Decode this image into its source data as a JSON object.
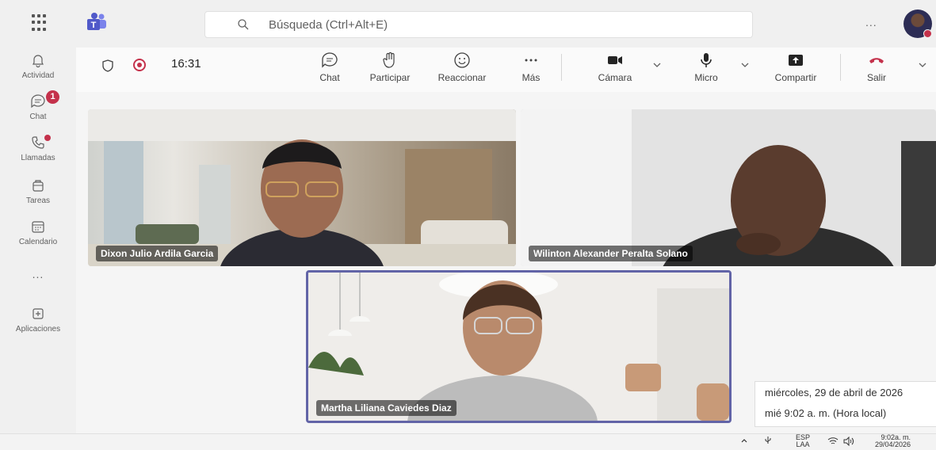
{
  "search": {
    "placeholder": "Búsqueda (Ctrl+Alt+E)"
  },
  "topbar": {
    "more_label": "..."
  },
  "rail": {
    "items": [
      {
        "label": "Actividad",
        "icon": "bell-icon"
      },
      {
        "label": "Chat",
        "icon": "chat-icon",
        "badge": "1"
      },
      {
        "label": "Llamadas",
        "icon": "phone-icon"
      },
      {
        "label": "Tareas",
        "icon": "tasks-icon"
      },
      {
        "label": "Calendario",
        "icon": "calendar-icon"
      },
      {
        "label": "...",
        "icon": "more-icon"
      },
      {
        "label": "Aplicaciones",
        "icon": "add-apps-icon"
      }
    ]
  },
  "toolbar": {
    "timer": "16:31",
    "chat": "Chat",
    "participar": "Participar",
    "reaccionar": "Reaccionar",
    "mas": "Más",
    "camara": "Cámara",
    "micro": "Micro",
    "compartir": "Compartir",
    "salir": "Salir"
  },
  "participants": [
    {
      "name": "Dixon Julio Ardila Garcia"
    },
    {
      "name": "Wilinton Alexander Peralta Solano"
    },
    {
      "name": "Martha Liliana Caviedes Diaz"
    }
  ],
  "clock_popup": {
    "date": "miércoles, 29 de abril de 2026",
    "time": "mié 9:02 a. m. (Hora local)"
  },
  "taskbar": {
    "lang": "ESP",
    "layout": "LAA",
    "time": "9:02a. m.",
    "date": "29/04/2026"
  },
  "colors": {
    "accent": "#6264a7",
    "leave": "#c4314b",
    "badge": "#c4314b"
  }
}
